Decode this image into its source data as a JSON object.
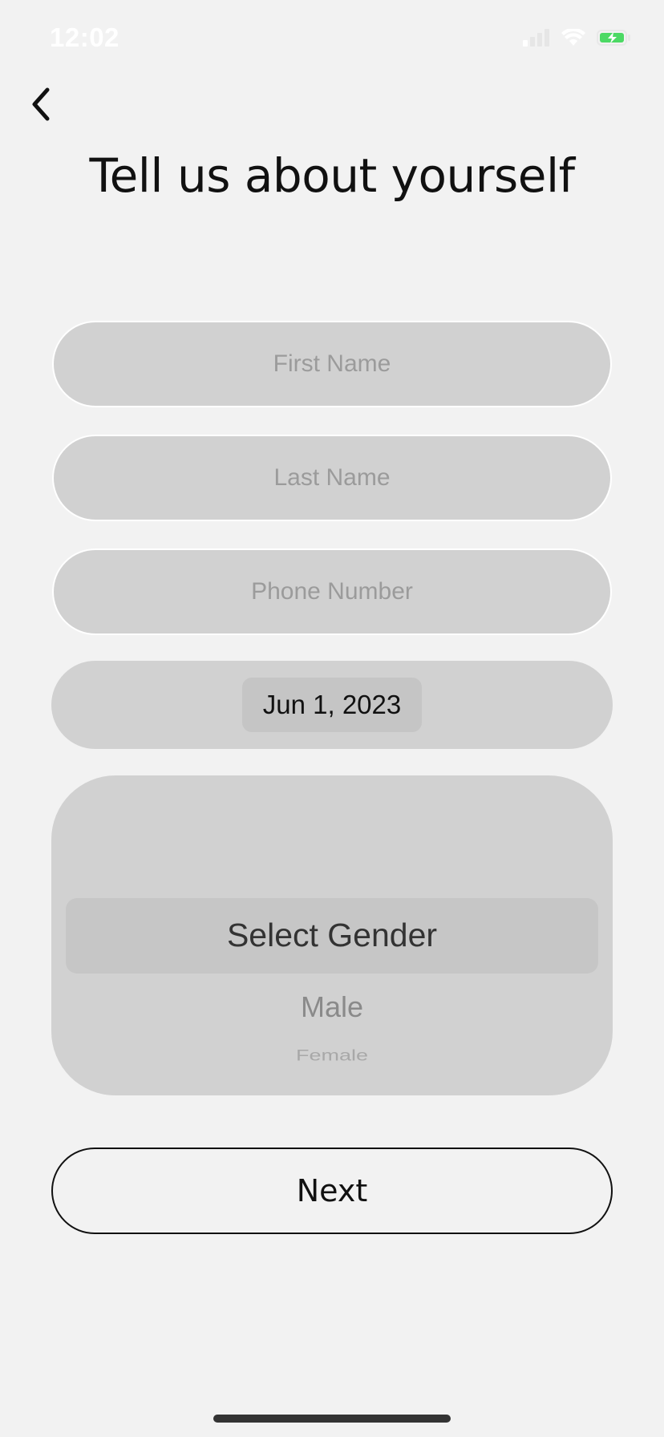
{
  "status_bar": {
    "time": "12:02",
    "signal_icon": "cellular-signal-icon",
    "wifi_icon": "wifi-icon",
    "battery_icon": "battery-charging-icon",
    "battery_color": "#4cd964"
  },
  "header": {
    "back_icon": "chevron-left-icon",
    "title": "Tell us about yourself"
  },
  "form": {
    "first_name": {
      "value": "",
      "placeholder": "First Name"
    },
    "last_name": {
      "value": "",
      "placeholder": "Last Name"
    },
    "phone_number": {
      "value": "",
      "placeholder": "Phone Number"
    },
    "birth_date": "Jun 1, 2023",
    "gender_picker": {
      "selected": "Select Gender",
      "options": [
        "Select Gender",
        "Male",
        "Female"
      ]
    }
  },
  "actions": {
    "next_label": "Next"
  },
  "colors": {
    "background": "#f2f2f2",
    "field_fill": "#d1d1d1",
    "text_primary": "#111111"
  }
}
